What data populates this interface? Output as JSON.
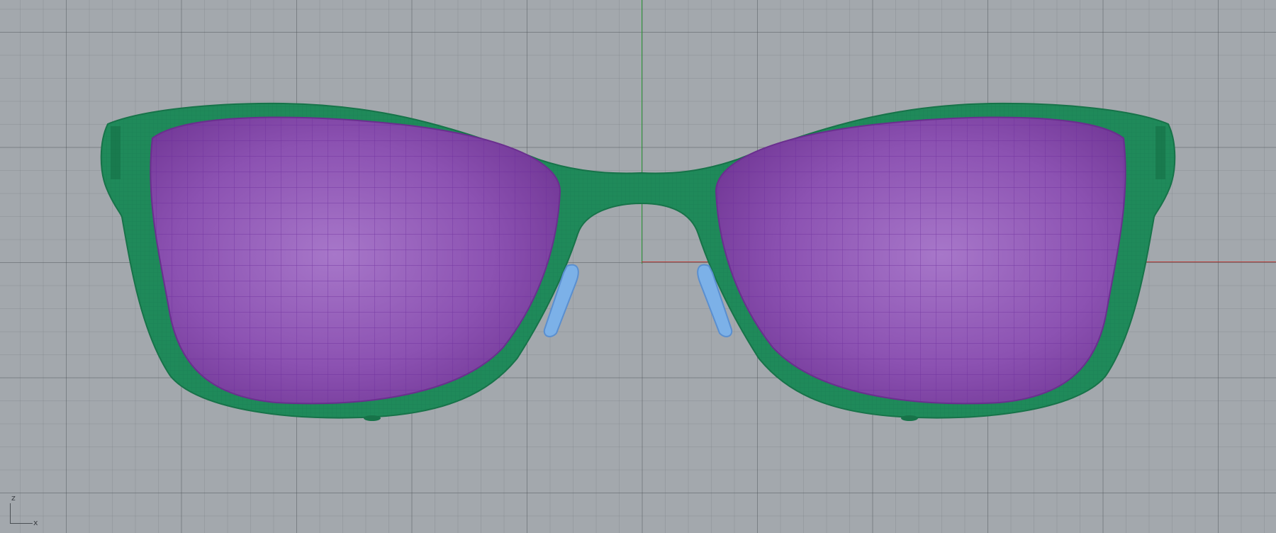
{
  "viewport": {
    "projection": "front",
    "background_color": "#a3a8ad",
    "grid_color": "#8c9196",
    "axis_colors": {
      "x": "#b63a34",
      "z": "#2f9a3a"
    }
  },
  "model": {
    "object": "sunglasses",
    "frame_color": "#1f8a5a",
    "lens_color": "#8a47ad",
    "nose_pad_color": "#7cb1e8"
  },
  "axis_gizmo": {
    "vertical_label": "z",
    "horizontal_label": "x"
  }
}
